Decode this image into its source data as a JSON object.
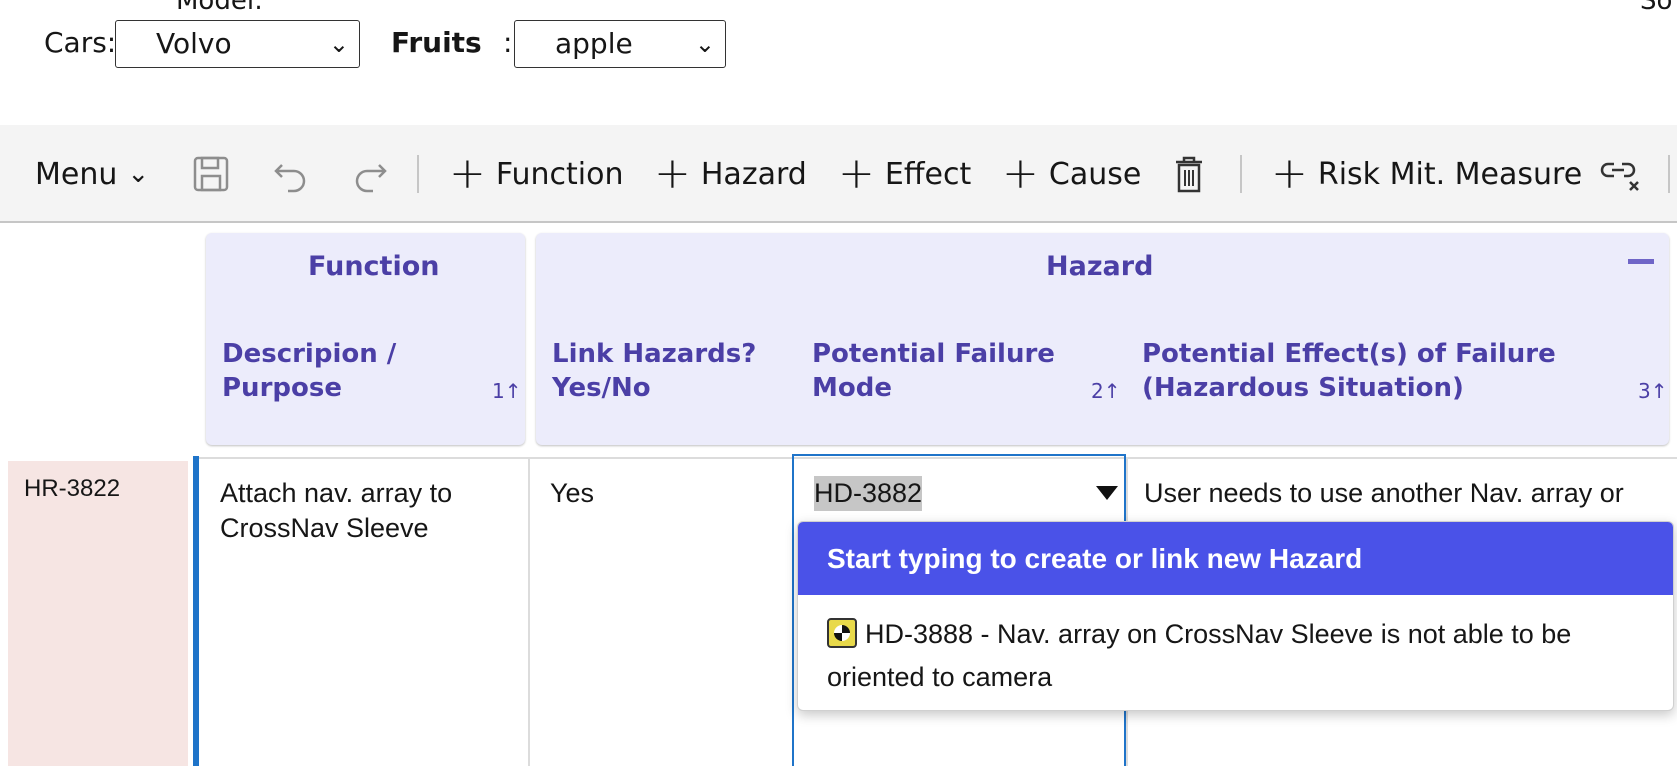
{
  "top_form": {
    "cut_label_left": "Model:",
    "cut_label_right": "So",
    "cars_label": "Cars:",
    "cars_value": "Volvo",
    "fruits_label": "Fruits",
    "fruits_colon": ":",
    "fruits_value": "apple"
  },
  "toolbar": {
    "menu_label": "Menu",
    "add_function": "Function",
    "add_hazard": "Hazard",
    "add_effect": "Effect",
    "add_cause": "Cause",
    "add_risk_measure": "Risk Mit. Measure"
  },
  "header": {
    "function_group": "Function",
    "hazard_group": "Hazard",
    "columns": [
      {
        "label_line1": "Descripion /",
        "label_line2": "Purpose",
        "sort": "1↑"
      },
      {
        "label_line1": "Link Hazards?",
        "label_line2": "Yes/No",
        "sort": ""
      },
      {
        "label_line1": "Potential Failure",
        "label_line2": "Mode",
        "sort": "2↑"
      },
      {
        "label_line1": "Potential Effect(s) of Failure",
        "label_line2": "(Hazardous Situation)",
        "sort": "3↑"
      }
    ]
  },
  "rows": [
    {
      "id": "HR-3822",
      "description_line1": "Attach nav. array to",
      "description_line2": "CrossNav Sleeve",
      "link_hazards": "Yes",
      "failure_mode": "HD-3882",
      "effect": "User needs to use another Nav. array or"
    }
  ],
  "dropdown": {
    "header": "Start typing to create or link new Hazard",
    "items": [
      {
        "text_line1": "HD-3888 - Nav. array on CrossNav Sleeve is not able to be",
        "text_line2": "oriented to camera",
        "icon": "hazard-icon"
      }
    ]
  }
}
